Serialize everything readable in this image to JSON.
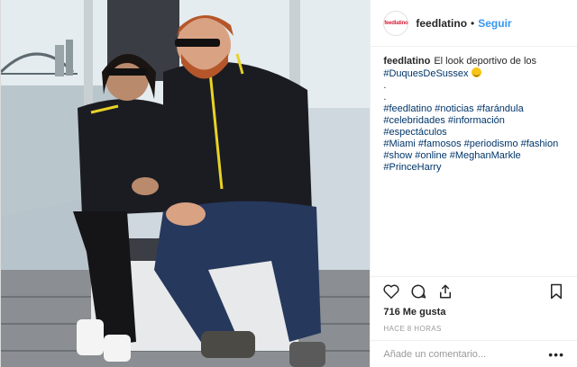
{
  "post": {
    "photo": {
      "description_icon": "photo-of-couple-on-boat",
      "colors": {
        "sky": "#e4ecef",
        "water": "#b9c6cc",
        "jacket": "#1b1c22",
        "accent": "#e8d227",
        "seat": "#e7e9ea",
        "jeans": "#26385c"
      }
    },
    "header": {
      "avatar_text": "feedlatino",
      "username": "feedlatino",
      "separator": "•",
      "follow_label": "Seguir"
    },
    "caption": {
      "username": "feedlatino",
      "text": "El look deportivo de los",
      "hashtag_line": "#DuquesDeSussex",
      "dots": [
        ".",
        "."
      ],
      "hashtags": [
        "#feedlatino",
        "#noticias",
        "#farándula",
        "#celebridades",
        "#información",
        "#espectáculos",
        "#Miami",
        "#famosos",
        "#periodismo",
        "#fashion",
        "#show",
        "#online",
        "#MeghanMarkle",
        "#PrinceHarry"
      ]
    },
    "actions": {
      "like_icon": "heart-icon",
      "comment_icon": "comment-bubble-icon",
      "share_icon": "share-arrow-icon",
      "save_icon": "bookmark-icon"
    },
    "likes": "716 Me gusta",
    "timestamp": "HACE 8 HORAS",
    "comment": {
      "placeholder": "Añade un comentario...",
      "more": "•••"
    }
  }
}
